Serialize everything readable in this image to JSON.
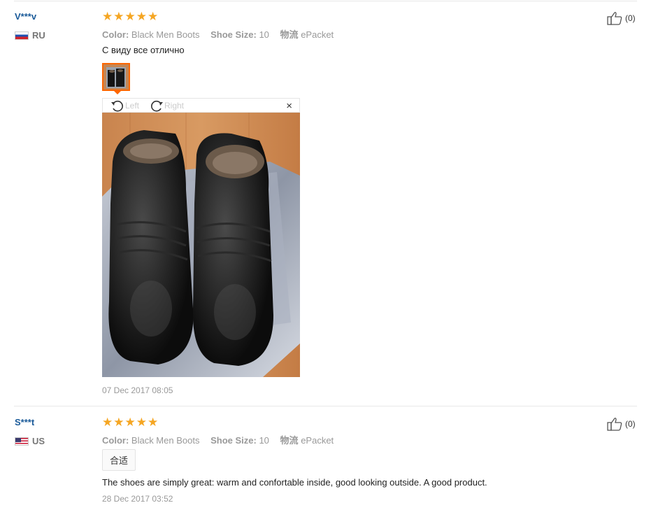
{
  "reviews": [
    {
      "user": "V***v",
      "country": "RU",
      "rating": 5,
      "color_label": "Color:",
      "color_value": "Black Men Boots",
      "size_label": "Shoe Size:",
      "size_value": "10",
      "shipping_label": "物流",
      "shipping_value": "ePacket",
      "text": "С виду все отлично",
      "viewer": {
        "left_label": "Left",
        "right_label": "Right",
        "close": "×"
      },
      "date": "07 Dec 2017 08:05",
      "likes": "(0)"
    },
    {
      "user": "S***t",
      "country": "US",
      "rating": 5,
      "color_label": "Color:",
      "color_value": "Black Men Boots",
      "size_label": "Shoe Size:",
      "size_value": "10",
      "shipping_label": "物流",
      "shipping_value": "ePacket",
      "tag": "合适",
      "text": "The shoes are simply great: warm and confortable inside, good looking outside. A good product.",
      "date": "28 Dec 2017 03:52",
      "likes": "(0)"
    }
  ],
  "colors": {
    "star": "#f5a623",
    "username": "#1a5a99",
    "accent": "#ff6600"
  },
  "icons": [
    "thumbs-up-icon",
    "rotate-left-icon",
    "rotate-right-icon",
    "close-icon",
    "star-icon",
    "flag-icon"
  ]
}
